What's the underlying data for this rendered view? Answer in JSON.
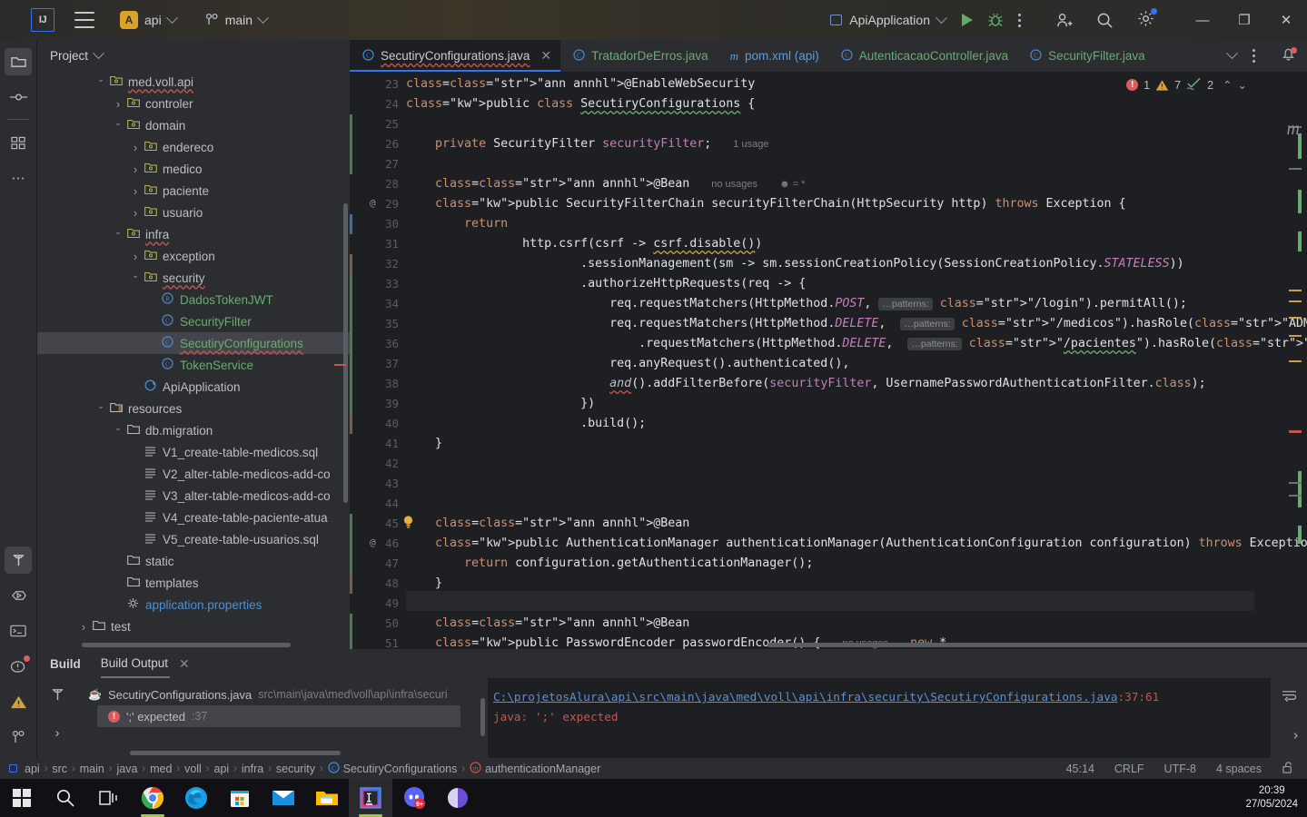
{
  "titlebar": {
    "ide_logo": "IJ",
    "menu_icon": "hamburger-icon",
    "project_badge": "A",
    "project_name": "api",
    "branch_icon": "vcs-branch-icon",
    "branch_name": "main",
    "run_config": "ApiApplication",
    "run_label": "run-icon",
    "debug_label": "debug-icon",
    "more_label": "more-icon",
    "icons": [
      "add-user-icon",
      "search-icon",
      "settings-gear-icon"
    ],
    "window_buttons": {
      "minimize": "—",
      "maximize": "❐",
      "close": "✕"
    }
  },
  "left_stripe": {
    "top": [
      "project-folder-icon",
      "commit-icon",
      "structure-icon",
      "more-tool-windows-icon"
    ],
    "bottom": [
      "build-hammer-icon",
      "run-icon",
      "terminal-icon",
      "problems-icon",
      "warning-icon",
      "git-branch-icon"
    ]
  },
  "project_pane": {
    "title": "Project",
    "tree": [
      {
        "indent": 3,
        "arrow": "down",
        "icon": "package",
        "label": "med.voll.api",
        "style": "plain",
        "wave": true
      },
      {
        "indent": 4,
        "arrow": "right",
        "icon": "package",
        "label": "controler",
        "style": "plain"
      },
      {
        "indent": 4,
        "arrow": "down",
        "icon": "package",
        "label": "domain",
        "style": "plain"
      },
      {
        "indent": 5,
        "arrow": "right",
        "icon": "package",
        "label": "endereco",
        "style": "plain"
      },
      {
        "indent": 5,
        "arrow": "right",
        "icon": "package",
        "label": "medico",
        "style": "plain"
      },
      {
        "indent": 5,
        "arrow": "right",
        "icon": "package",
        "label": "paciente",
        "style": "plain"
      },
      {
        "indent": 5,
        "arrow": "right",
        "icon": "package",
        "label": "usuario",
        "style": "plain"
      },
      {
        "indent": 4,
        "arrow": "down",
        "icon": "package",
        "label": "infra",
        "style": "plain",
        "wave": true
      },
      {
        "indent": 5,
        "arrow": "right",
        "icon": "package",
        "label": "exception",
        "style": "plain"
      },
      {
        "indent": 5,
        "arrow": "down",
        "icon": "package",
        "label": "security",
        "style": "plain",
        "wave": true
      },
      {
        "indent": 6,
        "arrow": "none",
        "icon": "record",
        "label": "DadosTokenJWT",
        "style": "green"
      },
      {
        "indent": 6,
        "arrow": "none",
        "icon": "class",
        "label": "SecurityFilter",
        "style": "green"
      },
      {
        "indent": 6,
        "arrow": "none",
        "icon": "class",
        "label": "SecutiryConfigurations",
        "style": "green",
        "wave": true,
        "selected": true
      },
      {
        "indent": 6,
        "arrow": "none",
        "icon": "class",
        "label": "TokenService",
        "style": "green"
      },
      {
        "indent": 5,
        "arrow": "none",
        "icon": "spring",
        "label": "ApiApplication",
        "style": "plain"
      },
      {
        "indent": 3,
        "arrow": "down",
        "icon": "resources",
        "label": "resources",
        "style": "plain"
      },
      {
        "indent": 4,
        "arrow": "down",
        "icon": "folder",
        "label": "db.migration",
        "style": "plain"
      },
      {
        "indent": 5,
        "arrow": "none",
        "icon": "sql",
        "label": "V1_create-table-medicos.sql",
        "style": "plain"
      },
      {
        "indent": 5,
        "arrow": "none",
        "icon": "sql",
        "label": "V2_alter-table-medicos-add-co",
        "style": "plain"
      },
      {
        "indent": 5,
        "arrow": "none",
        "icon": "sql",
        "label": "V3_alter-table-medicos-add-co",
        "style": "plain"
      },
      {
        "indent": 5,
        "arrow": "none",
        "icon": "sql",
        "label": "V4_create-table-paciente-atua",
        "style": "plain"
      },
      {
        "indent": 5,
        "arrow": "none",
        "icon": "sql",
        "label": "V5_create-table-usuarios.sql",
        "style": "plain"
      },
      {
        "indent": 4,
        "arrow": "none",
        "icon": "folder",
        "label": "static",
        "style": "plain"
      },
      {
        "indent": 4,
        "arrow": "none",
        "icon": "folder",
        "label": "templates",
        "style": "plain"
      },
      {
        "indent": 4,
        "arrow": "none",
        "icon": "props",
        "label": "application.properties",
        "style": "blue"
      },
      {
        "indent": 2,
        "arrow": "right",
        "icon": "folder",
        "label": "test",
        "style": "plain"
      }
    ]
  },
  "editor": {
    "tabs": [
      {
        "label": "SecutiryConfigurations.java",
        "icon": "class-icon",
        "active": true,
        "closable": true,
        "wave": true
      },
      {
        "label": "TratadorDeErros.java",
        "icon": "class-icon",
        "active": false,
        "color": "green"
      },
      {
        "label": "pom.xml (api)",
        "icon": "maven-icon",
        "active": false,
        "color": "blue"
      },
      {
        "label": "AutenticacaoController.java",
        "icon": "class-icon",
        "active": false,
        "color": "green"
      },
      {
        "label": "SecurityFilter.java",
        "icon": "class-icon",
        "active": false,
        "color": "green"
      }
    ],
    "tab_actions": [
      "chevron-down-icon",
      "kebab-icon",
      "notifications-bell-icon"
    ],
    "inspection_widget": {
      "errors": "1",
      "warnings": "7",
      "oks": "2",
      "up": "⌃",
      "down": "⌄"
    },
    "first_line_number": 23,
    "lines": [
      {
        "n": 23,
        "text": "@EnableWebSecurity"
      },
      {
        "n": 24,
        "text": "public class SecutiryConfigurations {"
      },
      {
        "n": 25,
        "text": ""
      },
      {
        "n": 26,
        "text": "    private SecurityFilter securityFilter;   1 usage"
      },
      {
        "n": 27,
        "text": ""
      },
      {
        "n": 28,
        "text": "    @Bean   no usages   ♂ = *"
      },
      {
        "n": 29,
        "text": "    public SecurityFilterChain securityFilterChain(HttpSecurity http) throws Exception {",
        "gutter_mark": "@"
      },
      {
        "n": 30,
        "text": "        return"
      },
      {
        "n": 31,
        "text": "                http.csrf(csrf -> csrf.disable())"
      },
      {
        "n": 32,
        "text": "                        .sessionManagement(sm -> sm.sessionCreationPolicy(SessionCreationPolicy.STATELESS))"
      },
      {
        "n": 33,
        "text": "                        .authorizeHttpRequests(req -> {"
      },
      {
        "n": 34,
        "text": "                            req.requestMatchers(HttpMethod.POST, ...patterns: \"/login\").permitAll();"
      },
      {
        "n": 35,
        "text": "                            req.requestMatchers(HttpMethod.DELETE,  ...patterns: \"/medicos\").hasRole(\"ADMIN\")"
      },
      {
        "n": 36,
        "text": "                                .requestMatchers(HttpMethod.DELETE,  ...patterns: \"/pacientes\").hasRole(\"ADMIN\");"
      },
      {
        "n": 37,
        "text": "                            req.anyRequest().authenticated(),"
      },
      {
        "n": 38,
        "text": "                            and().addFilterBefore(securityFilter, UsernamePasswordAuthenticationFilter.class);"
      },
      {
        "n": 39,
        "text": "                        })"
      },
      {
        "n": 40,
        "text": "                        .build();"
      },
      {
        "n": 41,
        "text": "    }"
      },
      {
        "n": 42,
        "text": ""
      },
      {
        "n": 43,
        "text": ""
      },
      {
        "n": 44,
        "text": ""
      },
      {
        "n": 45,
        "text": "    @Bean",
        "gutter_mark": "bulb"
      },
      {
        "n": 46,
        "text": "    public AuthenticationManager authenticationManager(AuthenticationConfiguration configuration) throws Exception",
        "gutter_mark": "@"
      },
      {
        "n": 47,
        "text": "        return configuration.getAuthenticationManager();"
      },
      {
        "n": 48,
        "text": "    }"
      },
      {
        "n": 49,
        "text": ""
      },
      {
        "n": 50,
        "text": "    @Bean"
      },
      {
        "n": 51,
        "text": "    public PasswordEncoder passwordEncoder() {   no usages   new *"
      }
    ]
  },
  "build_panel": {
    "tab_build": "Build",
    "tab_output": "Build Output",
    "close_icon": "close-icon",
    "side_icons": [
      "hammer-icon",
      "expand-arrow-icon"
    ],
    "tree": {
      "file_name": "SecutiryConfigurations.java",
      "file_path": "src\\main\\java\\med\\voll\\api\\infra\\securi",
      "error_text": "';' expected",
      "error_line": ":37"
    },
    "output": {
      "path_link": "C:\\projetosAlura\\api\\src\\main\\java\\med\\voll\\api\\infra\\security\\SecutiryConfigurations.java",
      "path_lineno": ":37:61",
      "message": "java: ';' expected"
    },
    "right_icons": [
      "soft-wrap-icon",
      "scroll-end-icon"
    ]
  },
  "status_bar": {
    "breadcrumbs": [
      "api",
      "src",
      "main",
      "java",
      "med",
      "voll",
      "api",
      "infra",
      "security",
      "SecutiryConfigurations",
      "authenticationManager"
    ],
    "caret_position": "45:14",
    "line_separator": "CRLF",
    "encoding": "UTF-8",
    "indent": "4 spaces",
    "lock_icon": "unlocked-padlock-icon"
  },
  "taskbar": {
    "items": [
      {
        "name": "start-button",
        "icon": "windows-logo"
      },
      {
        "name": "search-button",
        "icon": "search-icon"
      },
      {
        "name": "task-view-button",
        "icon": "task-view-icon"
      },
      {
        "name": "chrome-button",
        "icon": "chrome-icon",
        "running": true
      },
      {
        "name": "edge-button",
        "icon": "edge-icon"
      },
      {
        "name": "store-button",
        "icon": "microsoft-store-icon"
      },
      {
        "name": "mail-button",
        "icon": "mail-icon"
      },
      {
        "name": "explorer-button",
        "icon": "file-explorer-icon"
      },
      {
        "name": "intellij-button",
        "icon": "intellij-icon",
        "active": true,
        "running": true
      },
      {
        "name": "discord-button",
        "icon": "discord-icon",
        "badge": "9+"
      },
      {
        "name": "app-button",
        "icon": "purple-circle-icon"
      }
    ],
    "clock_time": "20:39",
    "clock_date": "27/05/2024"
  }
}
